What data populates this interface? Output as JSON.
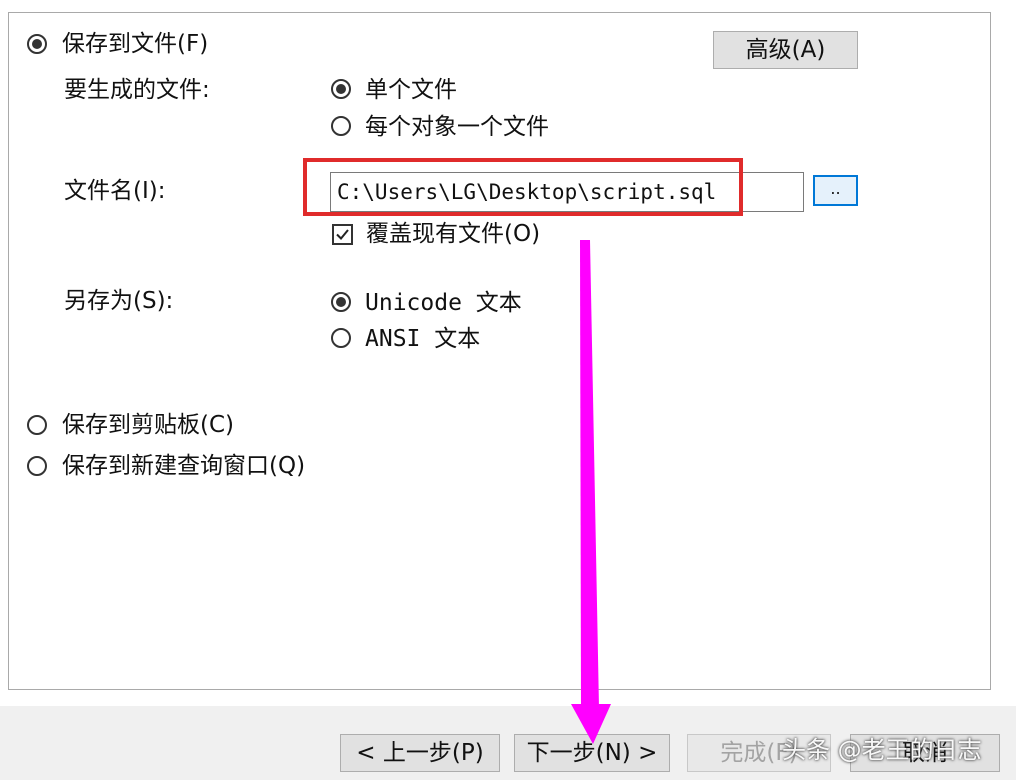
{
  "save_options": {
    "save_to_file": {
      "label": "保存到文件(F)",
      "selected": true
    },
    "advanced_button": "高级(A)",
    "files_to_generate": {
      "label": "要生成的文件:",
      "single_file": {
        "label": "单个文件",
        "selected": true
      },
      "one_per_object": {
        "label": "每个对象一个文件",
        "selected": false
      }
    },
    "file_name": {
      "label": "文件名(I):",
      "value": "C:\\Users\\LG\\Desktop\\script.sql",
      "browse_label": ".."
    },
    "overwrite": {
      "label": "覆盖现有文件(O)",
      "checked": true
    },
    "save_as": {
      "label": "另存为(S):",
      "unicode": {
        "label": "Unicode 文本",
        "selected": true
      },
      "ansi": {
        "label": "ANSI 文本",
        "selected": false
      }
    },
    "save_to_clipboard": {
      "label": "保存到剪贴板(C)",
      "selected": false
    },
    "save_to_query_window": {
      "label": "保存到新建查询窗口(Q)",
      "selected": false
    }
  },
  "footer": {
    "back": "< 上一步(P)",
    "next": "下一步(N) >",
    "finish": "完成(F)",
    "cancel": "取消"
  },
  "watermark": "头条 @老王的日志",
  "colors": {
    "highlight": "#e02b2b",
    "arrow": "#ff00ff",
    "focus": "#0078d7"
  }
}
